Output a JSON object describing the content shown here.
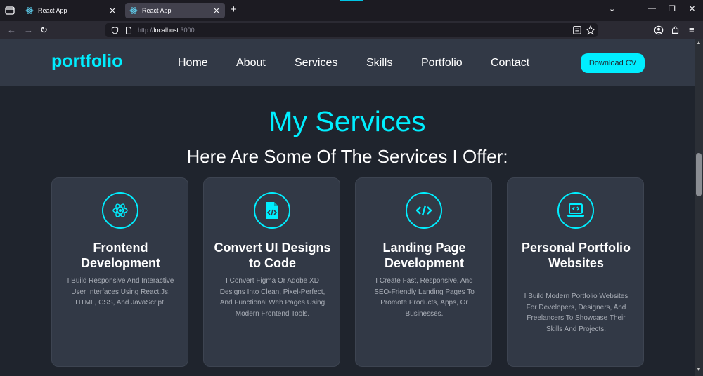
{
  "browser": {
    "tabs": [
      {
        "title": "React App"
      },
      {
        "title": "React App"
      }
    ],
    "url": {
      "scheme": "http://",
      "host": "localhost",
      "port": ":3000"
    }
  },
  "site": {
    "logo": "portfolio",
    "menu": [
      "Home",
      "About",
      "Services",
      "Skills",
      "Portfolio",
      "Contact"
    ],
    "cv_button": "Download CV",
    "heading": "My Services",
    "subheading": "Here Are Some Of The Services I Offer:",
    "accent_color": "#00eeff",
    "cards": [
      {
        "icon": "react-icon",
        "title": "Frontend Development",
        "desc": "I Build Responsive And Interactive User Interfaces Using React.Js, HTML, CSS, And JavaScript."
      },
      {
        "icon": "code-file-icon",
        "title": "Convert UI Designs to Code",
        "desc": "I Convert Figma Or Adobe XD Designs Into Clean, Pixel-Perfect, And Functional Web Pages Using Modern Frontend Tools."
      },
      {
        "icon": "code-icon",
        "title": "Landing Page Development",
        "desc": "I Create Fast, Responsive, And SEO-Friendly Landing Pages To Promote Products, Apps, Or Businesses."
      },
      {
        "icon": "laptop-code-icon",
        "title": "Personal Portfolio Websites",
        "desc": "I Build Modern Portfolio Websites For Developers, Designers, And Freelancers To Showcase Their Skills And Projects."
      }
    ]
  }
}
